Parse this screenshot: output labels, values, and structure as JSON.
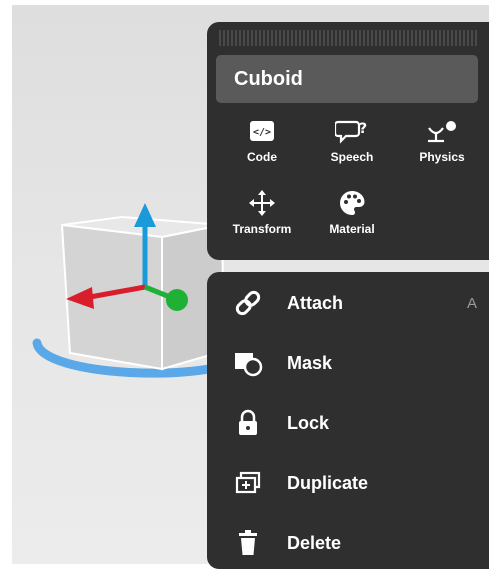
{
  "object_panel": {
    "title": "Cuboid",
    "tools": [
      {
        "label": "Code",
        "icon": "code-icon"
      },
      {
        "label": "Speech",
        "icon": "speech-icon"
      },
      {
        "label": "Physics",
        "icon": "physics-icon"
      },
      {
        "label": "Transform",
        "icon": "move-icon"
      },
      {
        "label": "Material",
        "icon": "palette-icon"
      }
    ]
  },
  "context_menu": {
    "items": [
      {
        "label": "Attach",
        "shortcut": "A",
        "icon": "link-icon"
      },
      {
        "label": "Mask",
        "icon": "mask-icon"
      },
      {
        "label": "Lock",
        "icon": "lock-icon"
      },
      {
        "label": "Duplicate",
        "icon": "duplicate-icon"
      },
      {
        "label": "Delete",
        "icon": "trash-icon"
      }
    ]
  },
  "colors": {
    "panel_bg": "#2f2f2f",
    "title_bg": "#5a5a5a",
    "axis_y": "#1a9ad8",
    "axis_x": "#d81e2a",
    "axis_z": "#1fb136",
    "rotation_ring": "#5aa8e8"
  }
}
